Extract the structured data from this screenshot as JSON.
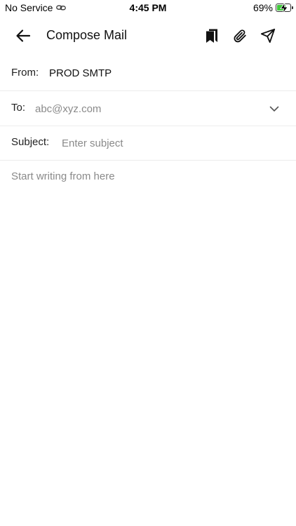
{
  "status_bar": {
    "carrier": "No Service",
    "time": "4:45 PM",
    "battery_percent": "69%",
    "battery_level": 0.69,
    "icons": [
      "link-icon",
      "battery-charging-icon"
    ]
  },
  "header": {
    "title": "Compose Mail",
    "icons": [
      "back-arrow-icon",
      "bookmark-icon",
      "paperclip-icon",
      "send-icon"
    ]
  },
  "form": {
    "from_label": "From:",
    "from_value": "PROD SMTP",
    "to_label": "To:",
    "to_placeholder": "abc@xyz.com",
    "subject_label": "Subject:",
    "subject_placeholder": "Enter subject",
    "body_placeholder": "Start writing from here"
  },
  "colors": {
    "battery_fill": "#3fc83a",
    "divider": "#ececec",
    "placeholder": "#8a8a8a"
  }
}
